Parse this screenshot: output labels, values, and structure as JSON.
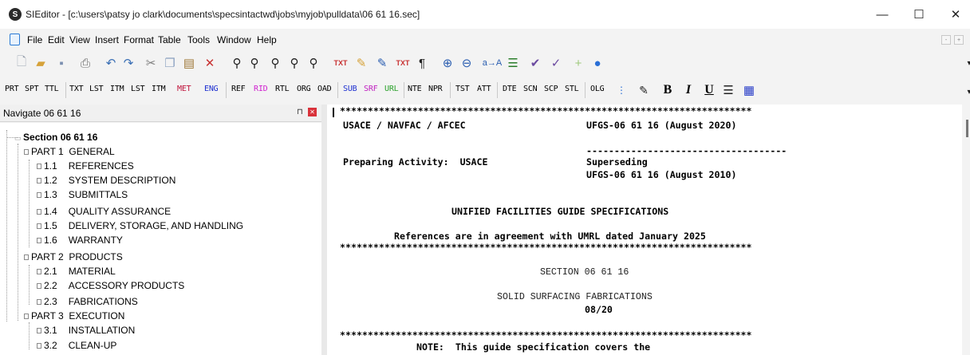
{
  "window": {
    "title": "SIEditor - [c:\\users\\patsy jo clark\\documents\\specsintactwd\\jobs\\myjob\\pulldata\\06 61 16.sec]",
    "app_icon_letter": "S",
    "minimize": "—",
    "maximize": "☐",
    "close": "✕"
  },
  "menu": {
    "items": [
      "File",
      "Edit",
      "View",
      "Insert",
      "Format",
      "Table",
      "Tools",
      "Window",
      "Help"
    ],
    "mdi_controls": [
      "-",
      "+"
    ]
  },
  "toolbar_tags": [
    "PRT",
    "SPT",
    "TTL",
    "TXT",
    "LST",
    "ITM",
    "LST",
    "ITM",
    "MET",
    "ENG",
    "REF",
    "RID",
    "RTL",
    "ORG",
    "OAD",
    "SUB",
    "SRF",
    "URL",
    "NTE",
    "NPR",
    "TST",
    "ATT",
    "DTE",
    "SCN",
    "SCP",
    "STL",
    "OLG"
  ],
  "tag_colors": {
    "MET": "#c0143c",
    "RID": "#d01fcf",
    "SUB": "#1d2fd0",
    "SRF": "#c020c0",
    "URL": "#2aa12a",
    "default": "#111111"
  },
  "format_buttons": {
    "bold": "B",
    "italic": "I",
    "underline": "U"
  },
  "navigator": {
    "title": "Navigate 06 61 16",
    "section": "Section 06 61 16",
    "parts": [
      {
        "label": "PART 1  GENERAL",
        "items": [
          {
            "num": "1.1",
            "label": "REFERENCES"
          },
          {
            "num": "1.2",
            "label": "SYSTEM DESCRIPTION"
          },
          {
            "num": "1.3",
            "label": "SUBMITTALS"
          },
          {
            "num": "1.4",
            "label": "QUALITY ASSURANCE"
          },
          {
            "num": "1.5",
            "label": "DELIVERY, STORAGE, AND HANDLING"
          },
          {
            "num": "1.6",
            "label": "WARRANTY"
          }
        ]
      },
      {
        "label": "PART 2  PRODUCTS",
        "items": [
          {
            "num": "2.1",
            "label": "MATERIAL"
          },
          {
            "num": "2.2",
            "label": "ACCESSORY PRODUCTS"
          },
          {
            "num": "2.3",
            "label": "FABRICATIONS"
          }
        ]
      },
      {
        "label": "PART 3  EXECUTION",
        "items": [
          {
            "num": "3.1",
            "label": "INSTALLATION"
          },
          {
            "num": "3.2",
            "label": "CLEAN-UP"
          }
        ]
      }
    ]
  },
  "editor": {
    "stars": "**************************************************************************",
    "agency": "USACE / NAVFAC / AFCEC",
    "ufgs": "UFGS-06 61 16 (August 2020)",
    "dash_line": "------------------------------------",
    "preparing": "Preparing Activity:  USACE",
    "superseding": "Superseding",
    "ufgs_prev": "UFGS-06 61 16 (August 2010)",
    "heading": "UNIFIED FACILITIES GUIDE SPECIFICATIONS",
    "references": "References are in agreement with UMRL dated January 2025",
    "section": "SECTION 06 61 16",
    "title": "SOLID SURFACING FABRICATIONS",
    "date": "08/20",
    "note": "NOTE:  This guide specification covers the"
  }
}
